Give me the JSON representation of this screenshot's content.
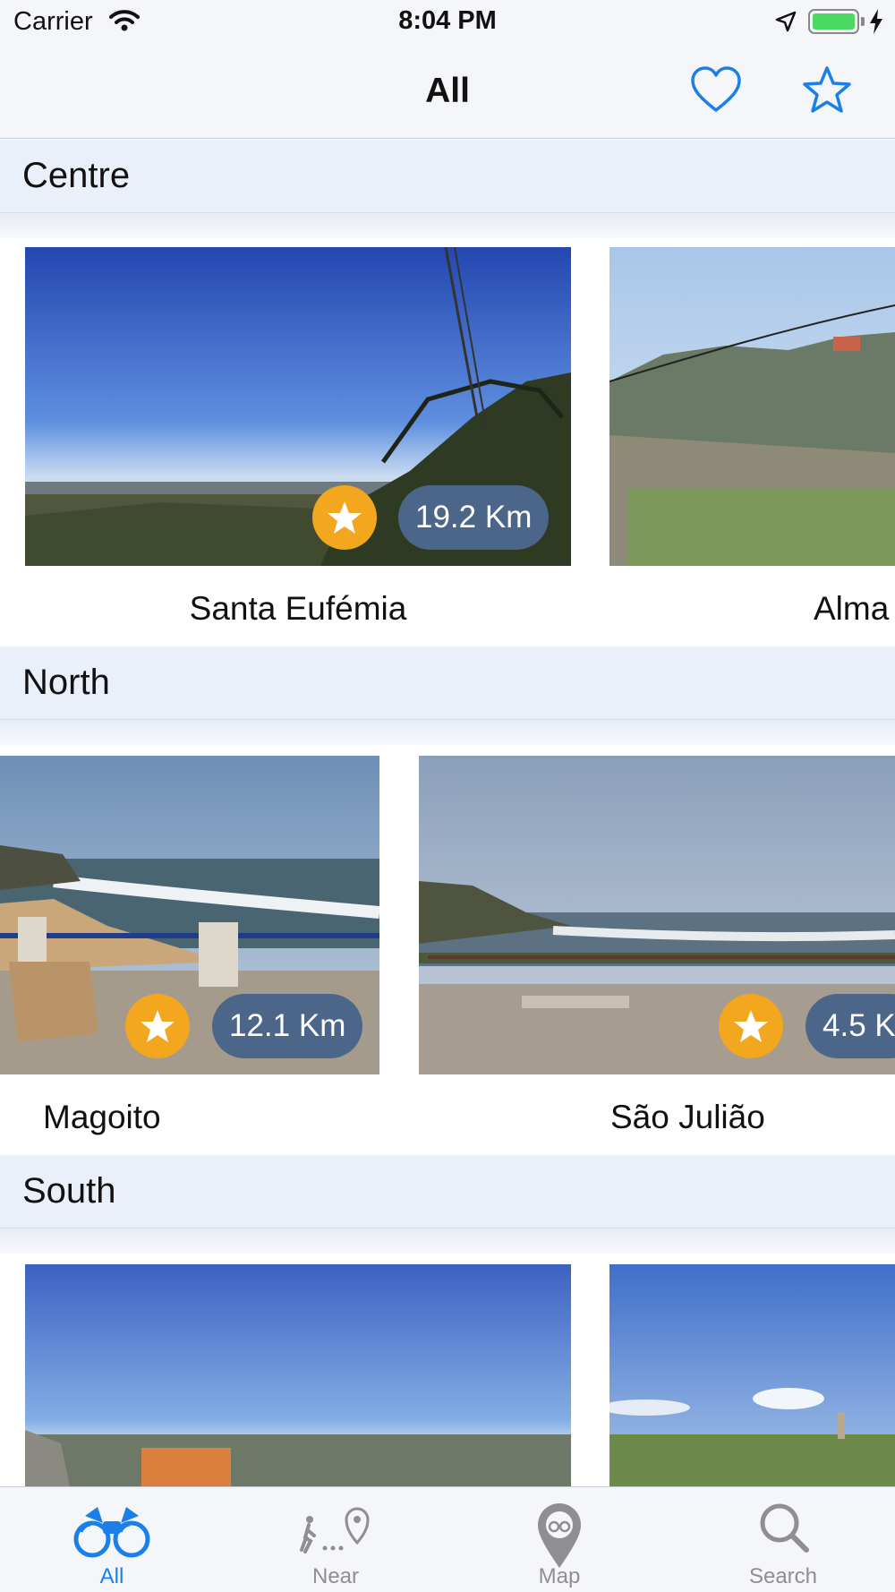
{
  "status_bar": {
    "carrier": "Carrier",
    "time": "8:04 PM",
    "battery_level": 1.0,
    "wifi_icon": "wifi-icon",
    "location_icon": "location-arrow-icon",
    "charging_icon": "bolt-icon"
  },
  "nav": {
    "title": "All",
    "favorites_icon": "heart-icon",
    "starred_icon": "star-icon"
  },
  "colors": {
    "accent": "#1a7fe8",
    "star_badge": "#f2a71e",
    "distance_pill": "#4b6688",
    "section_header_bg": "#eaf0fa",
    "bar_bg": "#f4f6fa",
    "inactive_tab": "#8e8e93"
  },
  "sections": [
    {
      "title": "Centre",
      "cards": [
        {
          "name": "Santa Eufémia",
          "distance": "19.2 Km",
          "starred": true
        },
        {
          "name": "Alma",
          "distance": "",
          "starred": false
        }
      ]
    },
    {
      "title": "North",
      "cards": [
        {
          "name": "Magoito",
          "distance": "12.1 Km",
          "starred": true
        },
        {
          "name": "São Julião",
          "distance": "4.5 K",
          "starred": true
        }
      ]
    },
    {
      "title": "South",
      "cards": [
        {
          "name": "",
          "distance": "",
          "starred": false
        },
        {
          "name": "",
          "distance": "",
          "starred": false
        }
      ]
    }
  ],
  "tabs": [
    {
      "label": "All",
      "icon": "binoculars-icon",
      "active": true
    },
    {
      "label": "Near",
      "icon": "walking-to-pin-icon",
      "active": false
    },
    {
      "label": "Map",
      "icon": "map-pin-icon",
      "active": false
    },
    {
      "label": "Search",
      "icon": "search-icon",
      "active": false
    }
  ]
}
